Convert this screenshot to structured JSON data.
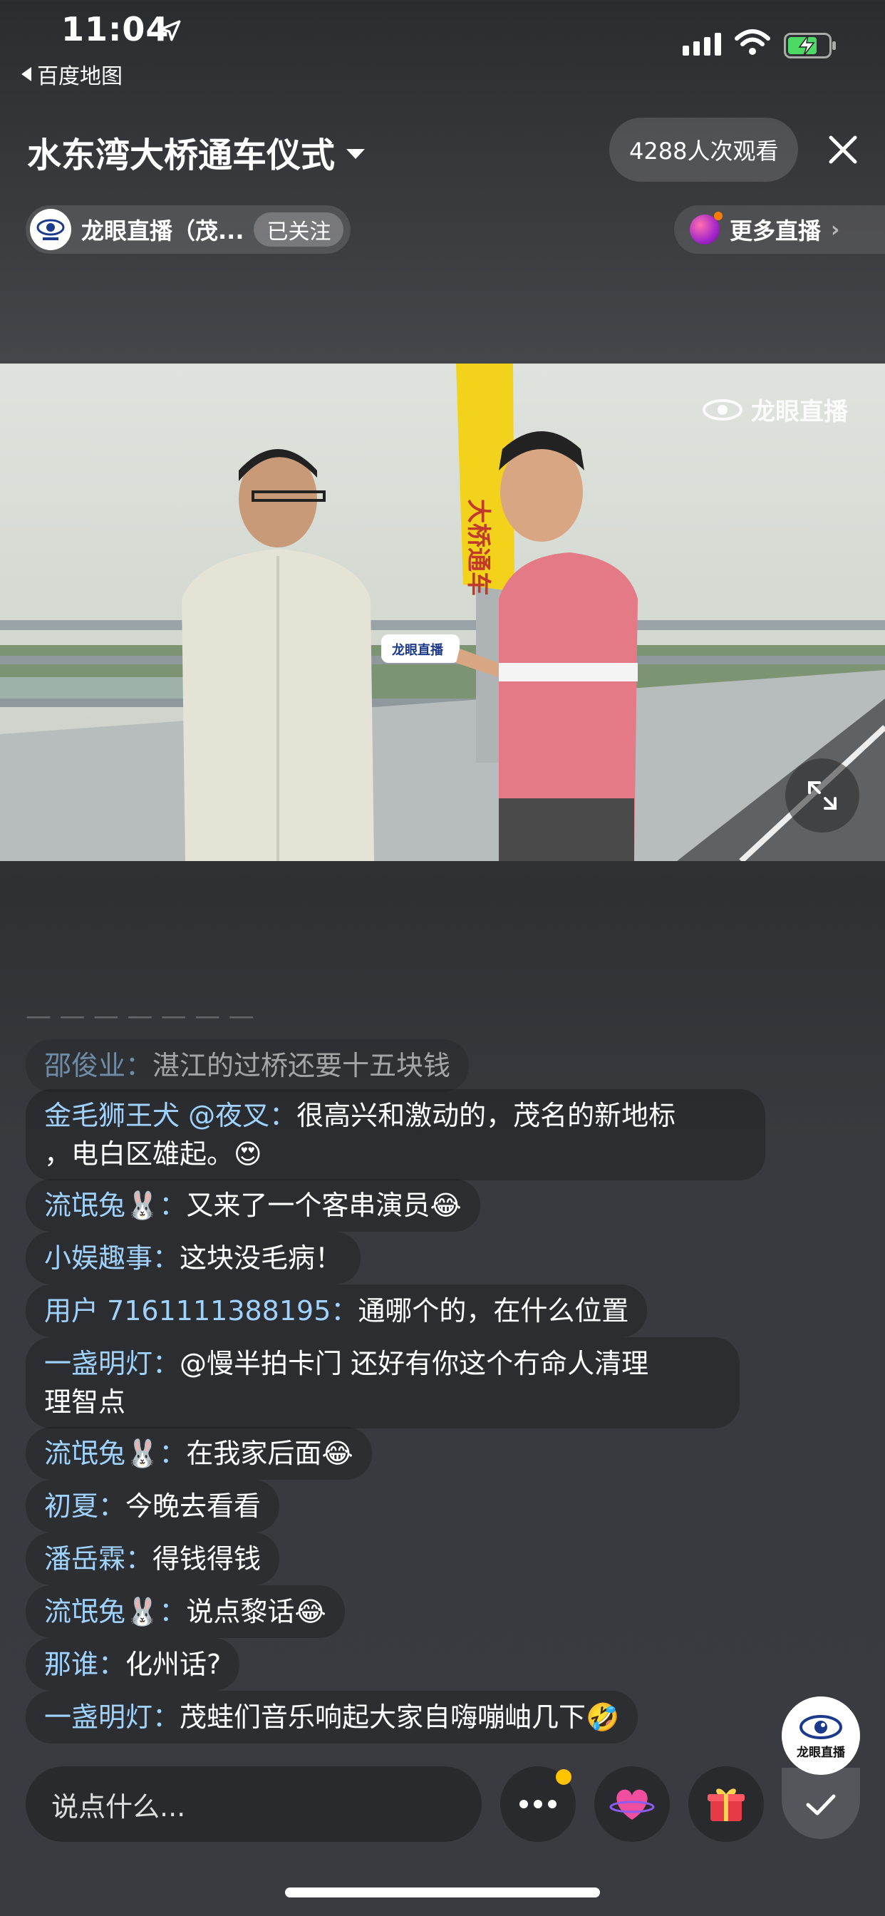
{
  "status_bar": {
    "time": "11:04",
    "back_app": "百度地图"
  },
  "header": {
    "title": "水东湾大桥通车仪式",
    "viewers": "4288人次观看",
    "channel_name": "龙眼直播（茂...",
    "follow_state": "已关注",
    "more_live": "更多直播"
  },
  "video": {
    "watermark": "龙眼直播"
  },
  "chat": {
    "messages": [
      {
        "nick": "邵俊业：",
        "text": "湛江的过桥还要十五块钱"
      },
      {
        "nick": "金毛狮王犬 @夜叉：",
        "text": "很高兴和激动的，茂名的新地标",
        "text2": "，电白区雄起。😍"
      },
      {
        "nick": "流氓兔🐰：",
        "text": "又来了一个客串演员😂"
      },
      {
        "nick": "小娱趣事：",
        "text": "这块没毛病！"
      },
      {
        "nick": "用户 7161111388195：",
        "text": "通哪个的，在什么位置"
      },
      {
        "nick": "一盏明灯：",
        "text": "@慢半拍卡门 还好有你这个冇命人清理",
        "text2": "理智点"
      },
      {
        "nick": "流氓兔🐰：",
        "text": "在我家后面😂"
      },
      {
        "nick": "初夏：",
        "text": "今晚去看看"
      },
      {
        "nick": "潘岳霖：",
        "text": "得钱得钱"
      },
      {
        "nick": "流氓兔🐰：",
        "text": "说点黎话😂"
      },
      {
        "nick": "那谁：",
        "text": "化州话?"
      },
      {
        "nick": "一盏明灯：",
        "text": "茂蛙们音乐响起大家自嗨嘣岫几下🤣"
      }
    ]
  },
  "floating_avatar_label": "龙眼直播",
  "bottom_bar": {
    "input_placeholder": "说点什么..."
  },
  "colors": {
    "nickname": "#9fd2ff",
    "notification_dot": "#ffc300"
  }
}
